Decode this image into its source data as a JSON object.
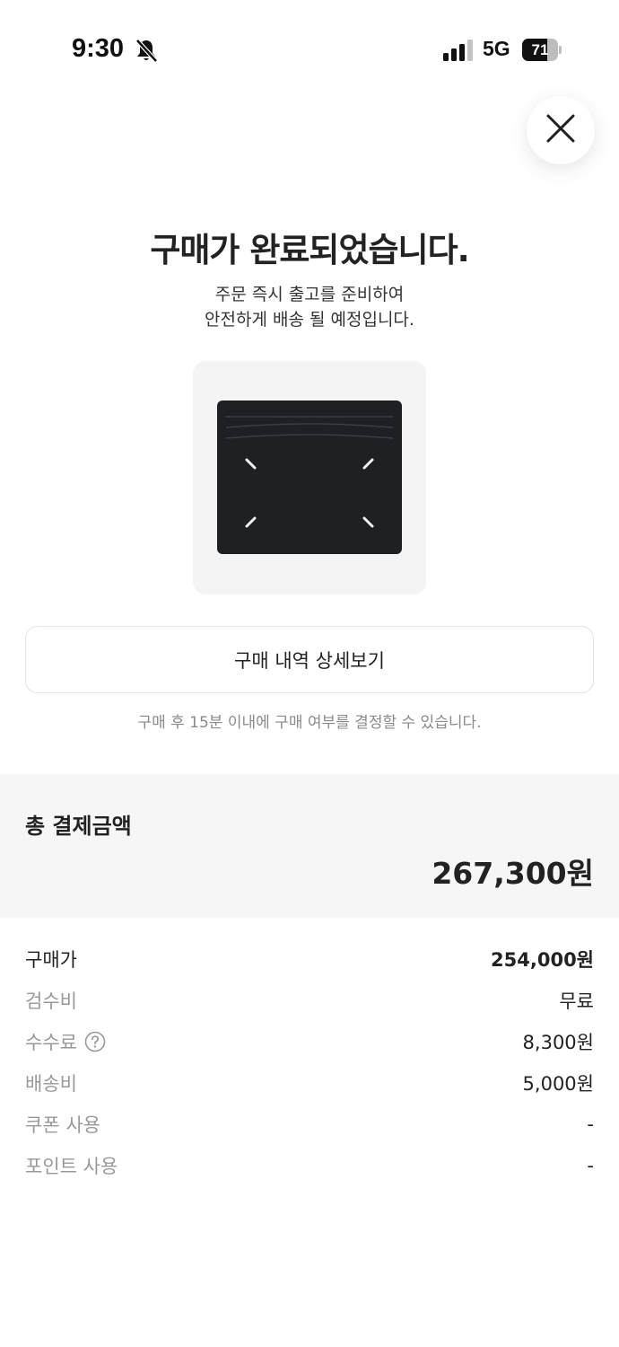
{
  "status_bar": {
    "time": "9:30",
    "network": "5G",
    "battery_level": "71",
    "battery_fraction": 0.71,
    "icons": [
      "mute-bell-icon",
      "signal-bars-icon",
      "battery-icon"
    ]
  },
  "close": {
    "icon": "close-icon"
  },
  "completion": {
    "title": "구매가 완료되었습니다.",
    "desc_line1": "주문 즉시 출고를 준비하여",
    "desc_line2": "안전하게 배송 될 예정입니다."
  },
  "detail_button": {
    "label": "구매 내역 상세보기"
  },
  "cancel_notice": "구매 후 15분 이내에 구매 여부를 결정할 수 있습니다.",
  "total": {
    "label": "총 결제금액",
    "amount": "267,300원"
  },
  "breakdown": [
    {
      "label": "구매가",
      "value": "254,000원"
    },
    {
      "label": "검수비",
      "value": "무료"
    },
    {
      "label": "수수료",
      "value": "8,300원"
    },
    {
      "label": "배송비",
      "value": "5,000원"
    },
    {
      "label": "쿠폰 사용",
      "value": "-"
    },
    {
      "label": "포인트 사용",
      "value": "-"
    }
  ],
  "colors": {
    "text_primary": "#222222",
    "text_muted": "#999999",
    "notice": "#8a8a8a",
    "section_bg": "#f6f6f6",
    "product_bg": "#f4f4f4",
    "wallet": "#1e2024"
  }
}
